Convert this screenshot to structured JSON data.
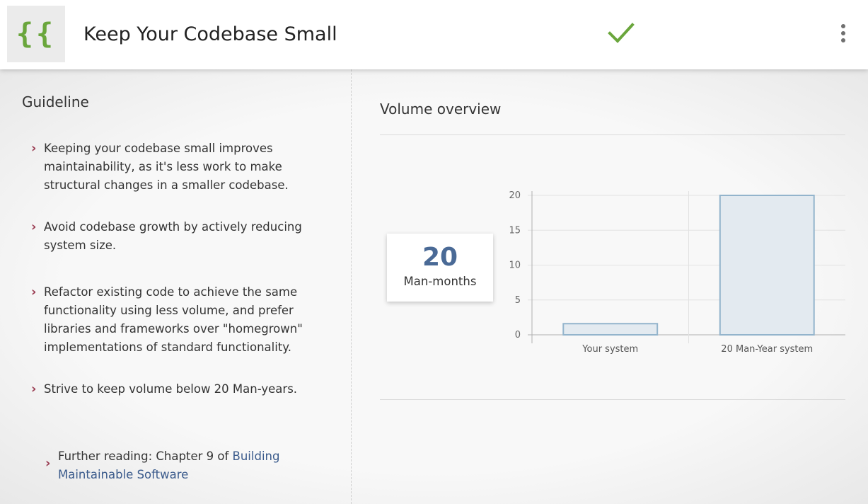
{
  "header": {
    "logo_text": "{{",
    "title": "Keep Your Codebase Small",
    "status_icon": "checkmark-icon",
    "menu_icon": "more-vert-icon",
    "accent_color": "#6aa63c"
  },
  "guideline": {
    "title": "Guideline",
    "items": [
      "Keeping your codebase small improves maintainability, as it's less work to make structural changes in a smaller codebase.",
      "Avoid codebase growth by actively reducing system size.",
      "Refactor existing code to achieve the same functionality using less volume, and prefer libraries and frameworks over \"homegrown\" implementations of standard functionality.",
      "Strive to keep volume below 20 Man-years."
    ],
    "further_reading_prefix": "Further reading: Chapter 9 of ",
    "further_reading_link": "Building Maintainable Software"
  },
  "volume": {
    "title": "Volume overview",
    "kpi_value": "20",
    "kpi_unit": "Man-months"
  },
  "chart_data": {
    "type": "bar",
    "categories": [
      "Your system",
      "20 Man-Year system"
    ],
    "values": [
      1.6,
      20
    ],
    "ylim": [
      0,
      20
    ],
    "yticks": [
      0,
      5,
      10,
      15,
      20
    ],
    "grid": true,
    "bar_fill": "#e3eaf0",
    "bar_stroke": "#93b4cc"
  }
}
